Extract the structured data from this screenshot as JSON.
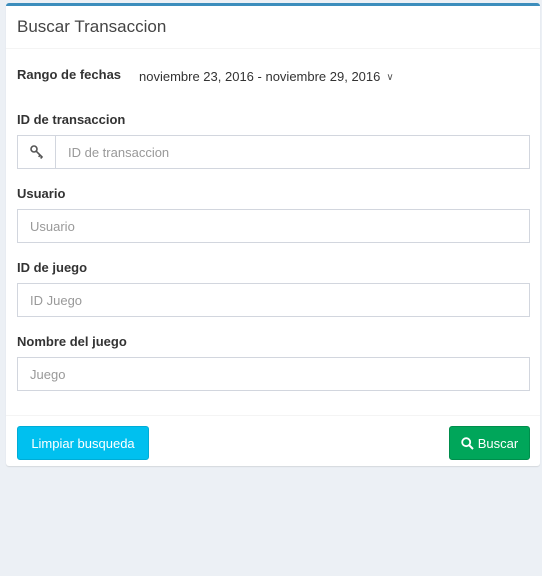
{
  "panel": {
    "title": "Buscar Transaccion"
  },
  "date_range": {
    "label": "Rango de fechas",
    "value": "noviembre 23, 2016 - noviembre 29, 2016"
  },
  "fields": {
    "transaction_id": {
      "label": "ID de transaccion",
      "placeholder": "ID de transaccion",
      "icon": "key-icon"
    },
    "user": {
      "label": "Usuario",
      "placeholder": "Usuario"
    },
    "game_id": {
      "label": "ID de juego",
      "placeholder": "ID Juego"
    },
    "game_name": {
      "label": "Nombre del juego",
      "placeholder": "Juego"
    }
  },
  "buttons": {
    "clear_label": "Limpiar busqueda",
    "search_label": "Buscar",
    "search_icon": "search-icon"
  },
  "colors": {
    "accent": "#3c8dbc",
    "info": "#00c0ef",
    "success": "#00a65a",
    "background": "#ecf0f5"
  }
}
